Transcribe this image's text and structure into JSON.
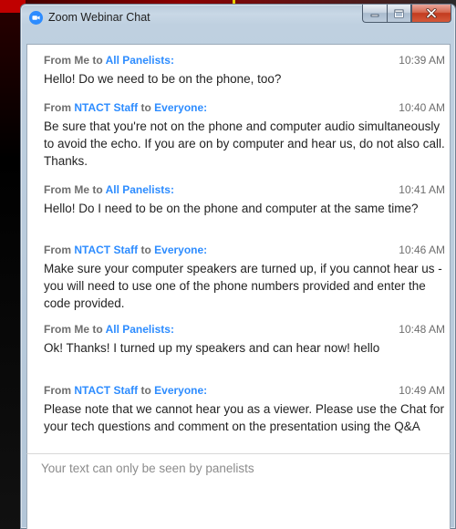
{
  "window": {
    "title": "Zoom Webinar Chat"
  },
  "messages": [
    {
      "sender": "Me",
      "connector": "to",
      "recipient": "All Panelists:",
      "time": "10:39 AM",
      "text": "Hello!  Do we need to be on the phone, too?"
    },
    {
      "sender": "NTACT Staff",
      "connector": "to",
      "recipient": "Everyone:",
      "time": "10:40 AM",
      "text": "Be sure that you're not on the phone and computer audio simultaneously to avoid the echo. If you are on by computer and hear us, do not also call. Thanks."
    },
    {
      "sender": "Me",
      "connector": "to",
      "recipient": "All Panelists:",
      "time": "10:41 AM",
      "text": "Hello!  Do I need to be on the phone and computer at the same time?"
    },
    {
      "sender": "NTACT Staff",
      "connector": "to",
      "recipient": "Everyone:",
      "time": "10:46 AM",
      "text": "Make sure your computer speakers are turned up, if you cannot hear us - you will need to use one of the phone numbers provided and enter the code provided."
    },
    {
      "sender": "Me",
      "connector": "to",
      "recipient": "All Panelists:",
      "time": "10:48 AM",
      "text": "Ok!  Thanks!  I turned up my speakers and can hear now!  hello"
    },
    {
      "sender": "NTACT Staff",
      "connector": "to",
      "recipient": "Everyone:",
      "time": "10:49 AM",
      "text": "Please note that we cannot hear you as a viewer. Please use the Chat for your tech questions and comment on the presentation using the Q&A"
    }
  ],
  "input": {
    "value": "",
    "placeholder": "Your text can only be seen by panelists"
  },
  "icons": {
    "app": "zoom-camera-icon",
    "minimize": "minimize-icon",
    "maximize": "maximize-icon",
    "close": "close-icon"
  },
  "colors": {
    "link_blue": "#2d8cff",
    "header_gray": "#6e6e6e",
    "close_red": "#c23b1e"
  }
}
